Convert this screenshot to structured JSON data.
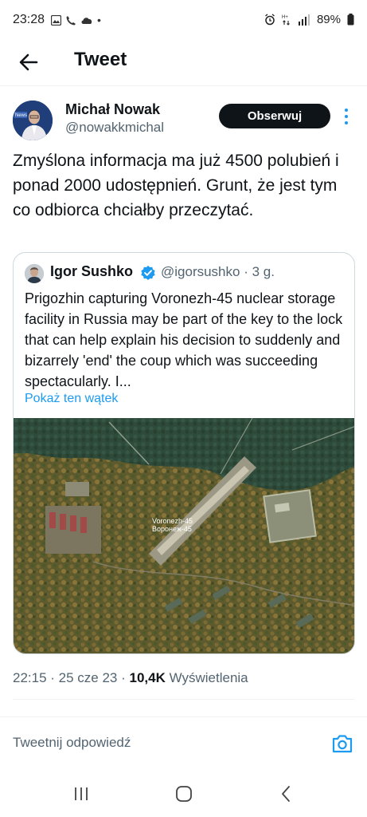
{
  "status": {
    "time": "23:28",
    "battery": "89%"
  },
  "header": {
    "title": "Tweet"
  },
  "author": {
    "name": "Michał Nowak",
    "handle": "@nowakkmichal",
    "follow_label": "Obserwuj"
  },
  "tweet": {
    "text": "Zmyślona informacja ma już 4500 polubień i ponad 2000 udostępnień. Grunt, że jest tym co odbiorca chciałby przeczytać."
  },
  "quote": {
    "name": "Igor Sushko",
    "handle_time": "@igorsushko · 3 g.",
    "text": "Prigozhin capturing Voronezh-45 nuclear storage facility in Russia may be part of the key to the lock that can help explain his decision to suddenly and bizarrely 'end' the coup which was succeeding spectacularly. I...",
    "show_thread": "Pokaż ten wątek",
    "map_label_1": "Voronezh-45",
    "map_label_2": "Воронеж-45"
  },
  "meta": {
    "time_date": "22:15 · 25 cze 23 · ",
    "views_count": "10,4K",
    "views_label": " Wyświetlenia"
  },
  "reply": {
    "placeholder": "Tweetnij odpowiedź"
  },
  "colors": {
    "link": "#1d9bf0",
    "follow_bg": "#0f1419",
    "secondary_text": "#536471"
  }
}
